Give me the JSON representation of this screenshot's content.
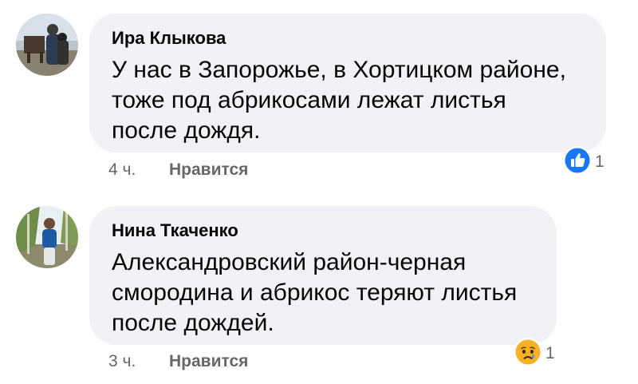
{
  "comments": [
    {
      "author": "Ира Клыкова",
      "text_lines": [
        "У нас в Запорожье, в Хортицком районе,",
        "тоже под абрикосами лежат листья",
        "после дождя."
      ],
      "time": "4 ч.",
      "like_label": "Нравится",
      "reaction_icon": "like-icon",
      "reaction_count": "1",
      "colors": {
        "reaction": "#1877f2"
      }
    },
    {
      "author": "Нина Ткаченко",
      "text_lines": [
        "Александровский район-черная",
        "смородина и абрикос теряют листья",
        "после дождей."
      ],
      "time": "3 ч.",
      "like_label": "Нравится",
      "reaction_icon": "sad-icon",
      "reaction_count": "1",
      "colors": {
        "reaction": "#f7b125"
      }
    }
  ],
  "colors": {
    "bubble": "#f0f2f5",
    "meta_text": "#65676b",
    "main_text": "#050505"
  }
}
